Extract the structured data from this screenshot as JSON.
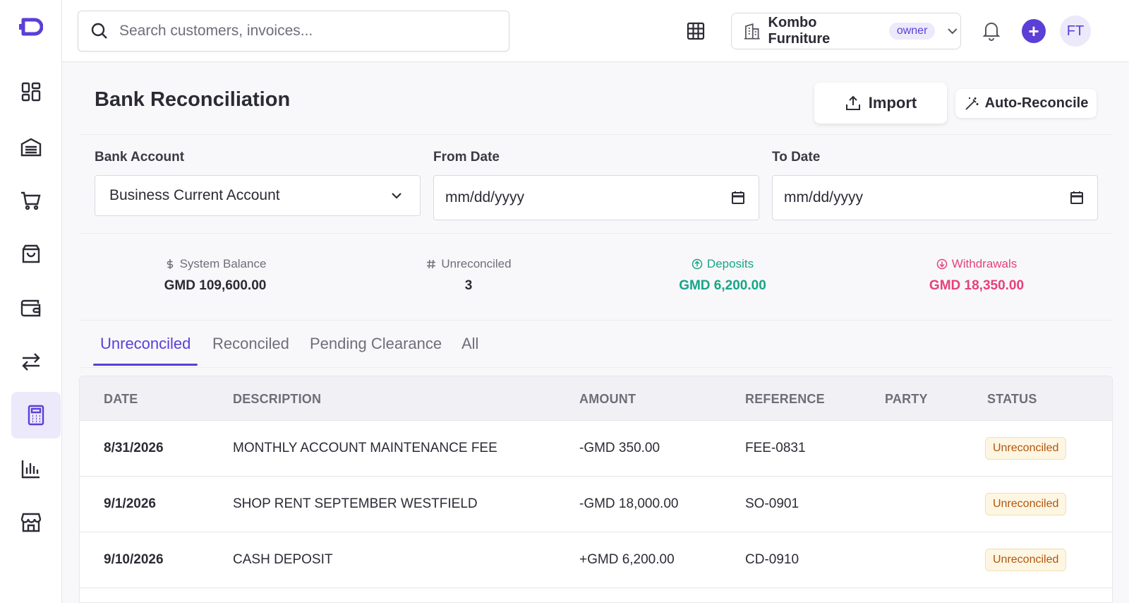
{
  "app": {
    "logo": "logo-mark"
  },
  "sidebar": {
    "items": [
      {
        "name": "dashboard-icon"
      },
      {
        "name": "inventory-icon"
      },
      {
        "name": "sales-cart-icon"
      },
      {
        "name": "purchases-bag-icon"
      },
      {
        "name": "wallet-icon"
      },
      {
        "name": "transfers-icon"
      },
      {
        "name": "calculator-icon",
        "active": true
      },
      {
        "name": "reports-chart-icon"
      },
      {
        "name": "store-icon"
      }
    ]
  },
  "topbar": {
    "search_placeholder": "Search customers, invoices...",
    "company_name": "Kombo Furniture",
    "company_role": "owner",
    "avatar_initials": "FT",
    "add_label": "+"
  },
  "page": {
    "title": "Bank Reconciliation",
    "import_label": "Import",
    "auto_reconcile_label": "Auto-Reconcile"
  },
  "filters": {
    "bank_account_label": "Bank Account",
    "bank_account_value": "Business Current Account",
    "from_date_label": "From Date",
    "from_date_value": "mm/dd/yyyy",
    "to_date_label": "To Date",
    "to_date_value": "mm/dd/yyyy"
  },
  "stats": {
    "system_balance_label": "System Balance",
    "system_balance_value": "GMD 109,600.00",
    "unreconciled_label": "Unreconciled",
    "unreconciled_value": "3",
    "deposits_label": "Deposits",
    "deposits_value": "GMD 6,200.00",
    "withdrawals_label": "Withdrawals",
    "withdrawals_value": "GMD 18,350.00"
  },
  "tabs": [
    {
      "label": "Unreconciled",
      "active": true
    },
    {
      "label": "Reconciled"
    },
    {
      "label": "Pending Clearance"
    },
    {
      "label": "All"
    }
  ],
  "table": {
    "headers": [
      "DATE",
      "DESCRIPTION",
      "AMOUNT",
      "REFERENCE",
      "PARTY",
      "STATUS"
    ],
    "rows": [
      {
        "date": "8/31/2026",
        "description": "MONTHLY ACCOUNT MAINTENANCE FEE",
        "amount": "-GMD 350.00",
        "reference": "FEE-0831",
        "party": "",
        "status": "Unreconciled"
      },
      {
        "date": "9/1/2026",
        "description": "SHOP RENT SEPTEMBER WESTFIELD",
        "amount": "-GMD 18,000.00",
        "reference": "SO-0901",
        "party": "",
        "status": "Unreconciled"
      },
      {
        "date": "9/10/2026",
        "description": "CASH DEPOSIT",
        "amount": "+GMD 6,200.00",
        "reference": "CD-0910",
        "party": "",
        "status": "Unreconciled"
      }
    ]
  },
  "colors": {
    "accent": "#5b3fd6",
    "deposit": "#16a589",
    "withdrawal": "#e6407a",
    "badge_text": "#b4540c",
    "badge_bg": "#fdf6e3"
  }
}
